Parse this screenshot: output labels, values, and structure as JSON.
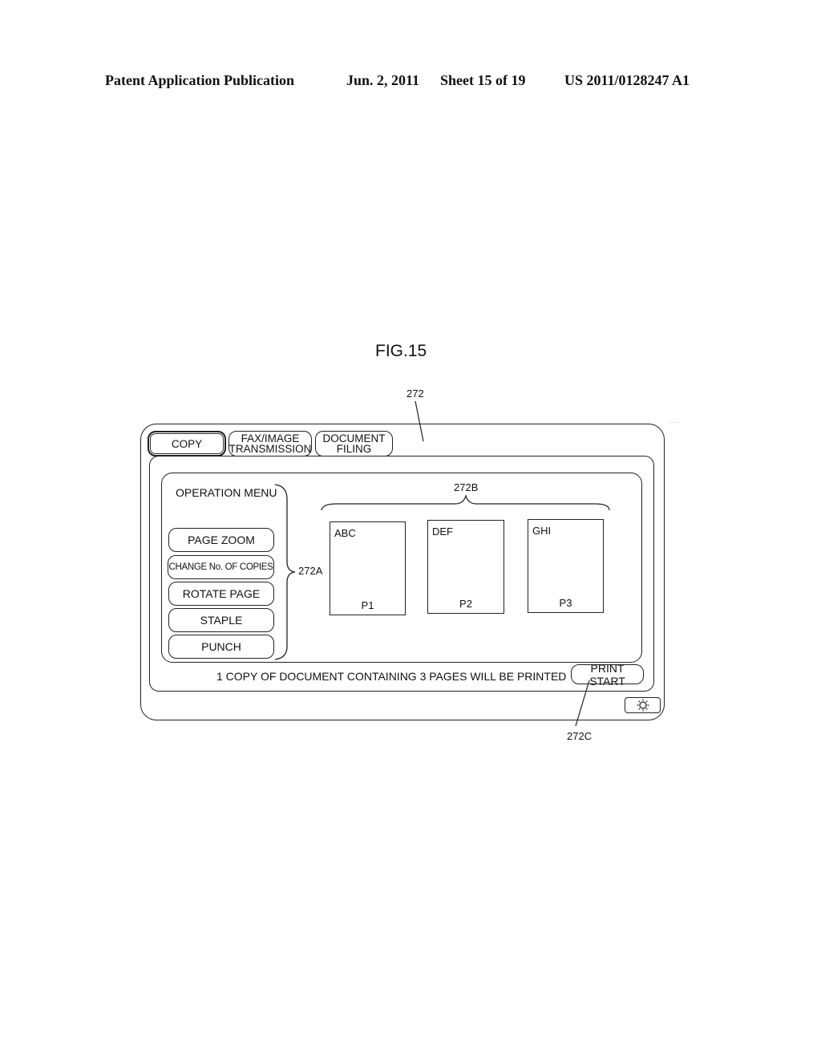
{
  "header": {
    "publication": "Patent Application Publication",
    "date": "Jun. 2, 2011",
    "sheet": "Sheet 15 of 19",
    "number": "US 2011/0128247 A1"
  },
  "figure": {
    "label": "FIG.15",
    "refs": {
      "screen": "272",
      "menu": "272A",
      "pages": "272B",
      "print": "272C"
    }
  },
  "screen": {
    "tabs": [
      {
        "line1": "COPY",
        "line2": "",
        "active": true
      },
      {
        "line1": "FAX/IMAGE",
        "line2": "TRANSMISSION",
        "active": false
      },
      {
        "line1": "DOCUMENT",
        "line2": "FILING",
        "active": false
      }
    ],
    "operation_menu": {
      "title": "OPERATION MENU",
      "items": [
        "PAGE ZOOM",
        "CHANGE No. OF COPIES",
        "ROTATE PAGE",
        "STAPLE",
        "PUNCH"
      ]
    },
    "pages": [
      {
        "title": "ABC",
        "number": "P1"
      },
      {
        "title": "DEF",
        "number": "P2"
      },
      {
        "title": "GHI",
        "number": "P3"
      }
    ],
    "status_message": "1 COPY OF DOCUMENT CONTAINING 3 PAGES WILL BE PRINTED",
    "print_button": "PRINT START",
    "brightness_icon": "sun-icon"
  }
}
